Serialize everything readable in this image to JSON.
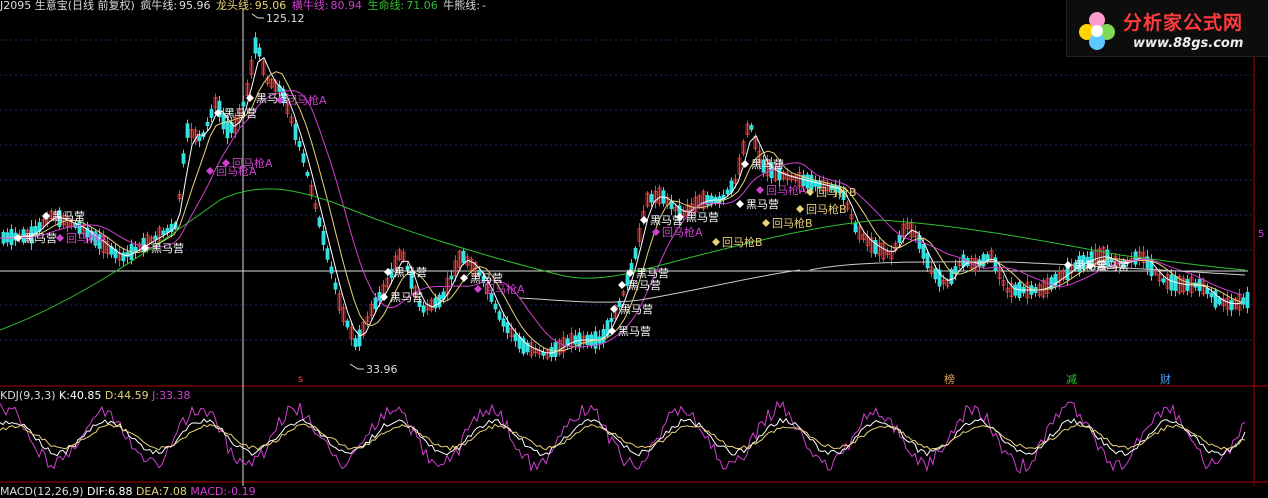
{
  "header": {
    "stock": "J2095 生意宝(日线 前复权)",
    "ind1_label": "疯牛线:",
    "ind1_value": "95.96",
    "ind2_label": "龙头线:",
    "ind2_value": "95.06",
    "ind3_label": "横牛线:",
    "ind3_value": "80.94",
    "ind4_label": "生命线:",
    "ind4_value": "71.06",
    "ind5_label": "牛熊线:",
    "ind5_value": "-"
  },
  "logo": {
    "title": "分析家公式网",
    "url": "www.88gs.com"
  },
  "price_chart": {
    "high_label": "125.12",
    "low_label": "33.96",
    "right_marker": "5",
    "signals": {
      "heima": "黑马营",
      "huima_a": "回马枪A",
      "huima_b": "回马枪B"
    },
    "bottom_markers": [
      "s",
      "榜",
      "减",
      "财"
    ],
    "colors": {
      "up": "#ff3c3c",
      "down": "#35e0e0",
      "ma_white": "#ffffff",
      "ma_yellow": "#e8d27a",
      "ma_magenta": "#d040d0",
      "ma_green": "#30c030"
    }
  },
  "kdj": {
    "title": "KDJ(9,3,3)",
    "k_label": "K:",
    "k_value": "40.85",
    "d_label": "D:",
    "d_value": "44.59",
    "j_label": "J:",
    "j_value": "33.38"
  },
  "macd": {
    "title": "MACD(12,26,9)",
    "dif_label": "DIF:",
    "dif_value": "6.88",
    "dea_label": "DEA:",
    "dea_value": "7.08",
    "macd_label": "MACD:",
    "macd_value": "-0.19"
  }
}
